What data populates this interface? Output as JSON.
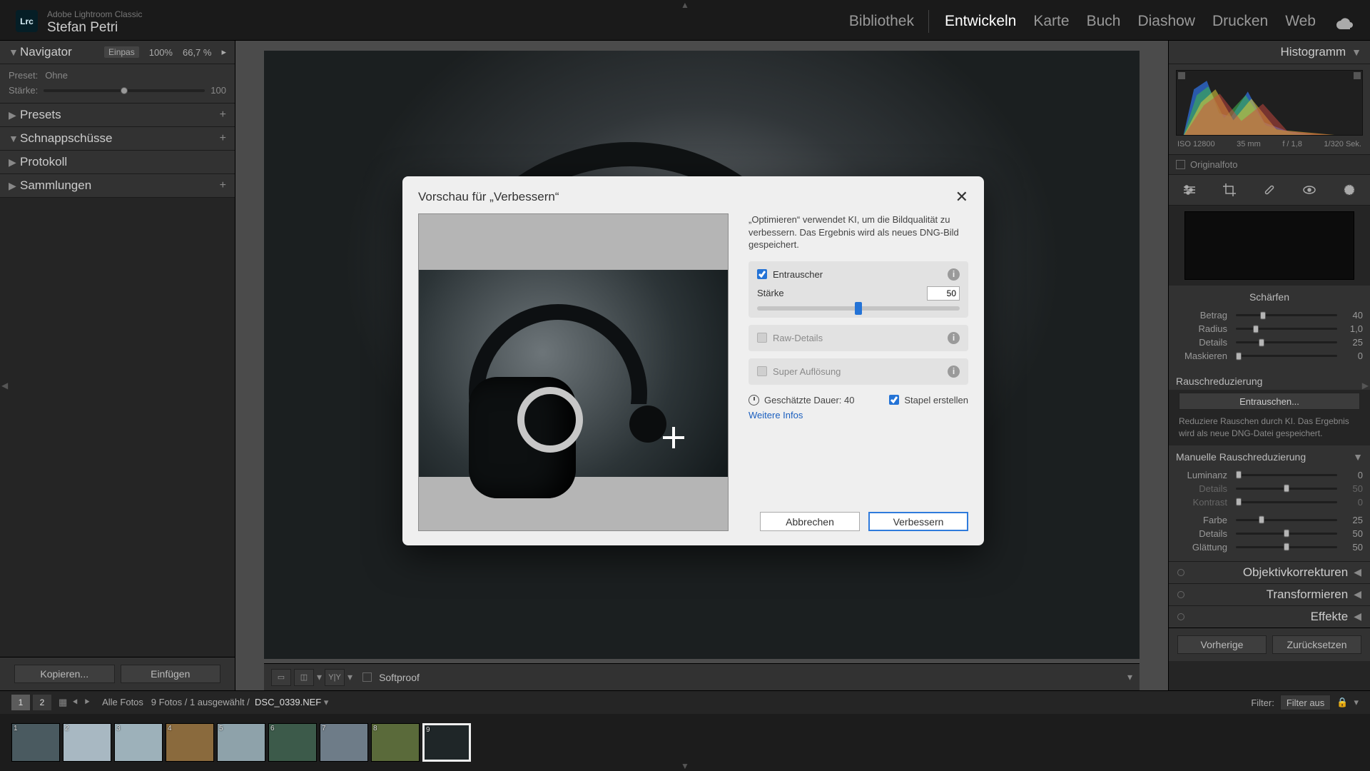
{
  "brand": {
    "small": "Adobe Lightroom Classic",
    "user": "Stefan Petri",
    "logo": "Lrc"
  },
  "tabs": {
    "bibliothek": "Bibliothek",
    "entwickeln": "Entwickeln",
    "karte": "Karte",
    "buch": "Buch",
    "diashow": "Diashow",
    "drucken": "Drucken",
    "web": "Web"
  },
  "left": {
    "navigator": "Navigator",
    "nav_fit": "Einpas",
    "nav_100": "100%",
    "nav_66": "66,7 %",
    "preset_label": "Preset:",
    "preset_value": "Ohne",
    "amount_label": "Stärke:",
    "amount_value": "100",
    "presets": "Presets",
    "snapshots": "Schnappschüsse",
    "history": "Protokoll",
    "collections": "Sammlungen",
    "copy": "Kopieren...",
    "paste": "Einfügen"
  },
  "canvas_tools": {
    "softproof": "Softproof"
  },
  "right": {
    "histogram": "Histogramm",
    "meta": {
      "iso": "ISO 12800",
      "focal": "35 mm",
      "aperture": "f / 1,8",
      "shutter": "1/320 Sek."
    },
    "original": "Originalfoto",
    "sharpen": "Schärfen",
    "s_betrag": {
      "l": "Betrag",
      "v": "40"
    },
    "s_radius": {
      "l": "Radius",
      "v": "1,0"
    },
    "s_details": {
      "l": "Details",
      "v": "25"
    },
    "s_mask": {
      "l": "Maskieren",
      "v": "0"
    },
    "nr_title": "Rauschreduzierung",
    "denoise_btn": "Entrauschen...",
    "denoise_info": "Reduziere Rauschen durch KI. Das Ergebnis wird als neue DNG-Datei gespeichert.",
    "manual_title": "Manuelle Rauschreduzierung",
    "m_lum": {
      "l": "Luminanz",
      "v": "0"
    },
    "m_ldet": {
      "l": "Details",
      "v": "50"
    },
    "m_lkon": {
      "l": "Kontrast",
      "v": "0"
    },
    "m_farbe": {
      "l": "Farbe",
      "v": "25"
    },
    "m_fdet": {
      "l": "Details",
      "v": "50"
    },
    "m_glatt": {
      "l": "Glättung",
      "v": "50"
    },
    "lens": "Objektivkorrekturen",
    "transform": "Transformieren",
    "effects": "Effekte",
    "prev": "Vorherige",
    "reset": "Zurücksetzen"
  },
  "filterbar": {
    "tab1": "1",
    "tab2": "2",
    "info": "Alle Fotos",
    "count": "9 Fotos / 1 ausgewählt /",
    "file": "DSC_0339.NEF",
    "filter_label": "Filter:",
    "filter_value": "Filter aus"
  },
  "filmstrip": {
    "count": 9
  },
  "modal": {
    "title": "Vorschau für „Verbessern“",
    "desc": "„Optimieren“ verwendet KI, um die Bildqualität zu verbessern. Das Ergebnis wird als neues DNG-Bild gespeichert.",
    "denoise": "Entrauscher",
    "amount_label": "Stärke",
    "amount_value": "50",
    "raw_details": "Raw-Details",
    "super_res": "Super Auflösung",
    "est": "Geschätzte Dauer: 40",
    "stack": "Stapel erstellen",
    "more": "Weitere Infos",
    "cancel": "Abbrechen",
    "enhance": "Verbessern"
  }
}
